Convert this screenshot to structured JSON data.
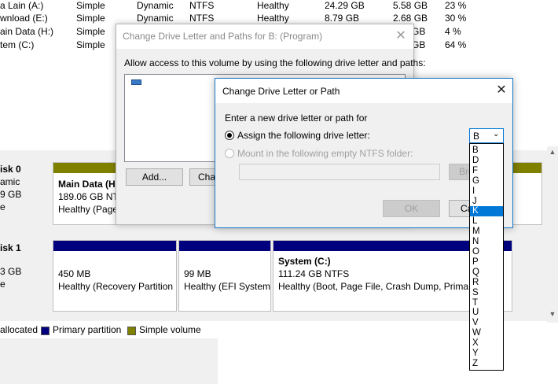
{
  "volume_rows": [
    {
      "name": "a Lain (A:)",
      "layout": "Simple",
      "type": "Dynamic",
      "fs": "NTFS",
      "status": "Healthy",
      "capacity": "24.29 GB",
      "free": "5.58 GB",
      "pct": "23 %"
    },
    {
      "name": "wnload (E:)",
      "layout": "Simple",
      "type": "Dynamic",
      "fs": "NTFS",
      "status": "Healthy",
      "capacity": "8.79 GB",
      "free": "2.68 GB",
      "pct": "30 %"
    },
    {
      "name": "ain Data (H:)",
      "layout": "Simple",
      "free_tail": "GB",
      "pct": "4 %"
    },
    {
      "name": "tem (C:)",
      "layout": "Simple",
      "free_tail": "GB",
      "pct": "64 %"
    }
  ],
  "disks": [
    {
      "label": "isk 0",
      "lines": [
        "amic",
        "9 GB",
        "e"
      ]
    },
    {
      "label": "isk 1",
      "lines": [
        "3 GB",
        "e"
      ]
    }
  ],
  "disk0_partitions": [
    {
      "title": "Main Data  (H:)",
      "size": "189.06 GB NTF",
      "status": "Healthy (Page"
    }
  ],
  "disk1_partitions": [
    {
      "size": "450 MB",
      "status": "Healthy (Recovery Partition"
    },
    {
      "size": "99 MB",
      "status": "Healthy (EFI System"
    },
    {
      "title": "System  (C:)",
      "size": "111.24 GB NTFS",
      "status": "Healthy (Boot, Page File, Crash Dump, Primary"
    }
  ],
  "legend": {
    "unallocated": "allocated",
    "primary": "Primary partition",
    "simple": "Simple volume"
  },
  "colors": {
    "primary": "#00007f",
    "simple": "#808000",
    "selection": "#0078d7"
  },
  "back_dialog": {
    "title": "Change Drive Letter and Paths for B: (Program)",
    "desc": "Allow access to this volume by using the following drive letter and paths:",
    "add_button": "Add...",
    "change_button": "Cha"
  },
  "front_dialog": {
    "title": "Change Drive Letter or Path",
    "prompt": "Enter a new drive letter or path for",
    "assign_option": "Assign the following drive letter:",
    "mount_option": "Mount in the following empty NTFS folder:",
    "browse_button": "Bro",
    "ok_button": "OK",
    "cancel_button": "Ca",
    "selected_letter": "B"
  },
  "letter_options": [
    "B",
    "D",
    "F",
    "G",
    "I",
    "J",
    "K",
    "L",
    "M",
    "N",
    "O",
    "P",
    "Q",
    "R",
    "S",
    "T",
    "U",
    "V",
    "W",
    "X",
    "Y",
    "Z"
  ],
  "highlighted_letter": "K"
}
